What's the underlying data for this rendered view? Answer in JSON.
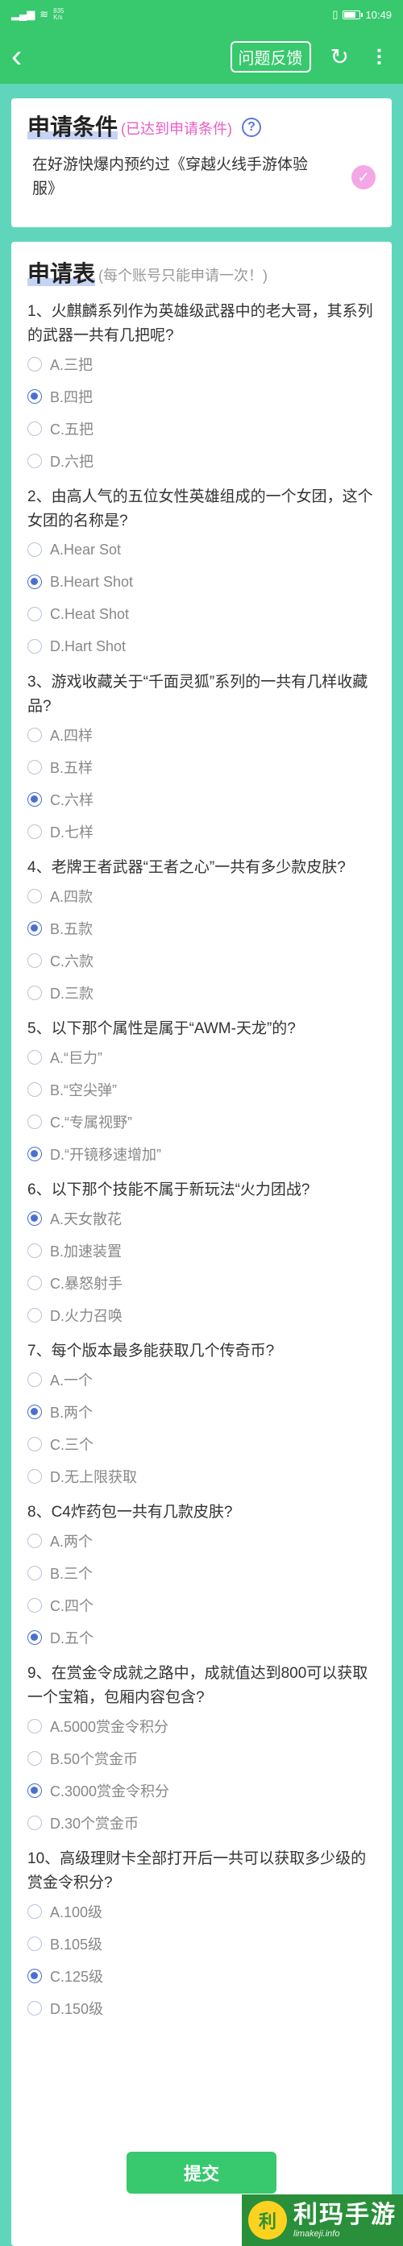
{
  "status_bar": {
    "speed_value": "835",
    "speed_unit": "K/s",
    "battery_level": 0.7,
    "time": "10:49"
  },
  "app_bar": {
    "back_icon": "chevron-left-icon",
    "feedback_label": "问题反馈",
    "refresh_icon": "refresh-icon",
    "more_icon": "more-vertical-icon"
  },
  "conditions": {
    "title": "申请条件",
    "status": "(已达到申请条件)",
    "help_icon": "?",
    "item_text": "在好游快爆内预约过《穿越火线手游体验服》",
    "check_icon": "✓",
    "met": true
  },
  "form": {
    "title": "申请表",
    "note": "(每个账号只能申请一次！)",
    "questions": [
      {
        "text": "1、火麒麟系列作为英雄级武器中的老大哥，其系列的武器一共有几把呢?",
        "options": [
          "A.三把",
          "B.四把",
          "C.五把",
          "D.六把"
        ],
        "selected": 1
      },
      {
        "text": "2、由高人气的五位女性英雄组成的一个女团，这个女团的名称是?",
        "options": [
          "A.Hear Sot",
          "B.Heart Shot",
          "C.Heat Shot",
          "D.Hart Shot"
        ],
        "selected": 1
      },
      {
        "text": "3、游戏收藏关于“千面灵狐”系列的一共有几样收藏品?",
        "options": [
          "A.四样",
          "B.五样",
          "C.六样",
          "D.七样"
        ],
        "selected": 2
      },
      {
        "text": "4、老牌王者武器“王者之心”一共有多少款皮肤?",
        "options": [
          "A.四款",
          "B.五款",
          "C.六款",
          "D.三款"
        ],
        "selected": 1
      },
      {
        "text": "5、以下那个属性是属于“AWM-天龙”的?",
        "options": [
          "A.“巨力”",
          "B.“空尖弹”",
          "C.“专属视野”",
          "D.“开镜移速增加”"
        ],
        "selected": 3
      },
      {
        "text": "6、以下那个技能不属于新玩法“火力团战?",
        "options": [
          "A.天女散花",
          "B.加速装置",
          "C.暴怒射手",
          "D.火力召唤"
        ],
        "selected": 0
      },
      {
        "text": "7、每个版本最多能获取几个传奇币?",
        "options": [
          "A.一个",
          "B.两个",
          "C.三个",
          "D.无上限获取"
        ],
        "selected": 1
      },
      {
        "text": "8、C4炸药包一共有几款皮肤?",
        "options": [
          "A.两个",
          "B.三个",
          "C.四个",
          "D.五个"
        ],
        "selected": 3
      },
      {
        "text": "9、在赏金令成就之路中，成就值达到800可以获取一个宝箱，包厢内容包含?",
        "options": [
          "A.5000赏金令积分",
          "B.50个赏金币",
          "C.3000赏金令积分",
          "D.30个赏金币"
        ],
        "selected": 2
      },
      {
        "text": "10、高级理财卡全部打开后一共可以获取多少级的赏金令积分?",
        "options": [
          "A.100级",
          "B.105级",
          "C.125级",
          "D.150级"
        ],
        "selected": 2
      }
    ],
    "submit_label": "提交"
  },
  "watermark": {
    "logo_glyph": "利",
    "title": "利玛手游",
    "url": "limakeji.info"
  }
}
